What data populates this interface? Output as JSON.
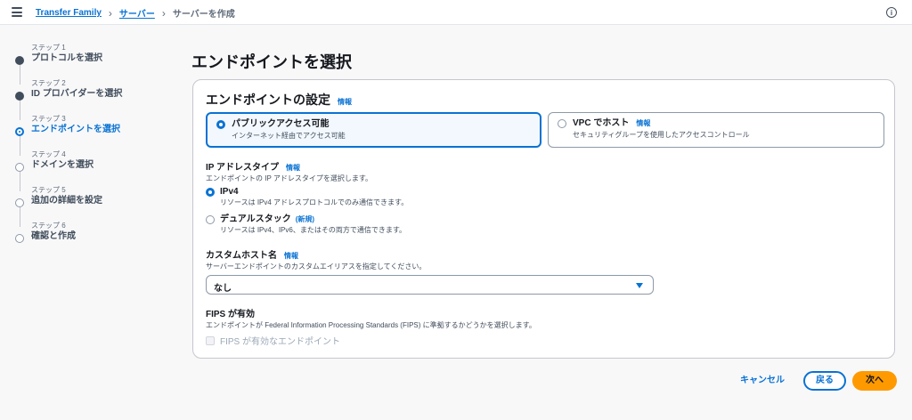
{
  "breadcrumb": {
    "items": [
      "Transfer Family",
      "サーバー"
    ],
    "current": "サーバーを作成"
  },
  "steps": [
    {
      "label": "ステップ 1",
      "title": "プロトコルを選択",
      "state": "done"
    },
    {
      "label": "ステップ 2",
      "title": "ID プロバイダーを選択",
      "state": "done"
    },
    {
      "label": "ステップ 3",
      "title": "エンドポイントを選択",
      "state": "current"
    },
    {
      "label": "ステップ 4",
      "title": "ドメインを選択",
      "state": "pending"
    },
    {
      "label": "ステップ 5",
      "title": "追加の詳細を設定",
      "state": "pending"
    },
    {
      "label": "ステップ 6",
      "title": "確認と作成",
      "state": "pending"
    }
  ],
  "page_title": "エンドポイントを選択",
  "card": {
    "title": "エンドポイントの設定",
    "info": "情報",
    "endpoint_options": [
      {
        "title": "パブリックアクセス可能",
        "desc": "インターネット経由でアクセス可能",
        "selected": true
      },
      {
        "title": "VPC でホスト",
        "info": "情報",
        "desc": "セキュリティグループを使用したアクセスコントロール",
        "selected": false
      }
    ],
    "ip_type": {
      "label": "IP アドレスタイプ",
      "info": "情報",
      "desc": "エンドポイントの IP アドレスタイプを選択します。",
      "options": [
        {
          "title": "IPv4",
          "desc": "リソースは IPv4 アドレスプロトコルでのみ通信できます。",
          "selected": true
        },
        {
          "title": "デュアルスタック",
          "badge": "(新規)",
          "desc": "リソースは IPv4、IPv6、またはその両方で通信できます。",
          "selected": false
        }
      ]
    },
    "custom_host": {
      "label": "カスタムホスト名",
      "info": "情報",
      "desc": "サーバーエンドポイントのカスタムエイリアスを指定してください。",
      "selected_value": "なし"
    },
    "fips": {
      "label": "FIPS が有効",
      "desc": "エンドポイントが Federal Information Processing Standards (FIPS) に準拠するかどうかを選択します。",
      "checkbox_label": "FIPS が有効なエンドポイント",
      "checked": false,
      "disabled": true
    }
  },
  "footer": {
    "cancel": "キャンセル",
    "back": "戻る",
    "next": "次へ"
  },
  "colors": {
    "accent": "#0972d3",
    "primary_button": "#ff9900",
    "text": "#16191f"
  }
}
